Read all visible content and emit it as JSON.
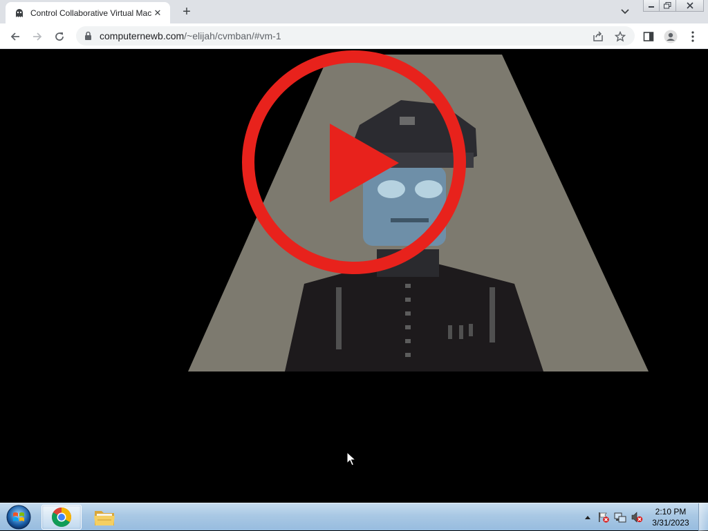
{
  "browser": {
    "tab": {
      "title": "Control Collaborative Virtual Mac",
      "favicon": "ghost-icon",
      "close_icon": "close-icon"
    },
    "new_tab_icon": "plus-icon",
    "tab_search_icon": "chevron-down-icon",
    "window_controls": [
      "minimize-icon",
      "restore-icon",
      "close-icon"
    ],
    "toolbar": {
      "back_icon": "back-arrow-icon",
      "forward_icon": "forward-arrow-icon",
      "reload_icon": "reload-icon",
      "lock_icon": "lock-icon",
      "url_domain": "computernewb.com",
      "url_path": "/~elijah/cvmban/#vm-1",
      "share_icon": "share-icon",
      "bookmark_icon": "star-icon",
      "side_panel_icon": "side-panel-icon",
      "profile_icon": "profile-icon",
      "menu_icon": "kebab-menu-icon"
    }
  },
  "page": {
    "background": "#000000",
    "content": "vm-video-screen",
    "play_button_color": "#e8221c",
    "spotlight_color": "#7d7a6f"
  },
  "taskbar": {
    "start_icon": "windows-orb-icon",
    "items": [
      {
        "name": "chrome-icon",
        "active": true
      },
      {
        "name": "folder-icon",
        "active": false
      }
    ],
    "tray_icons": [
      "show-hidden-icons-arrow",
      "action-center-flag-icon",
      "network-icon",
      "volume-muted-icon"
    ],
    "clock_time": "2:10 PM",
    "clock_date": "3/31/2023"
  }
}
